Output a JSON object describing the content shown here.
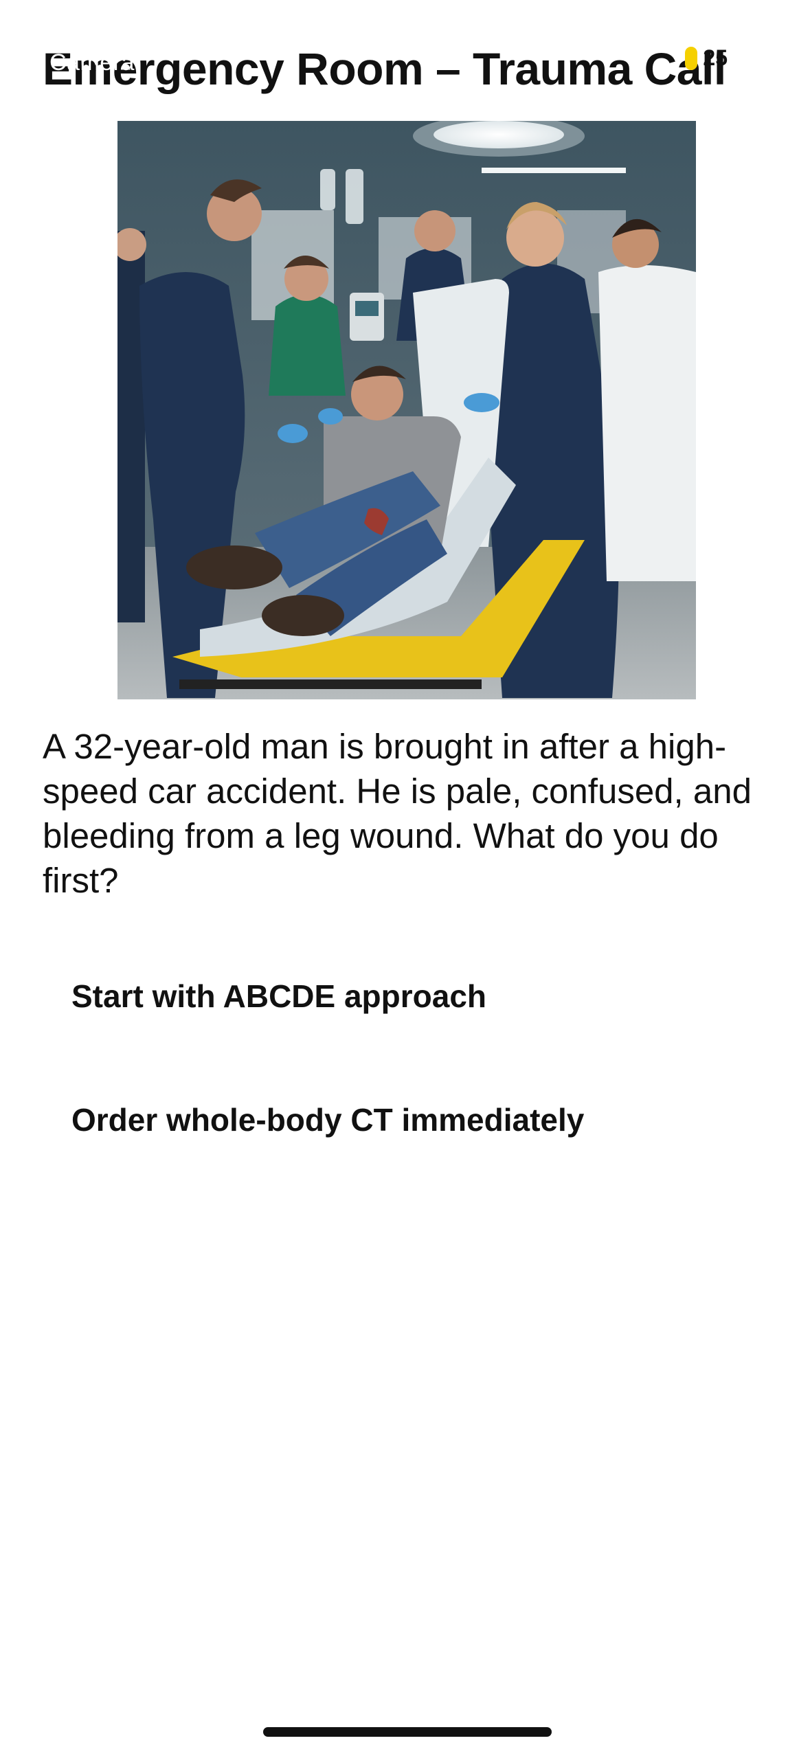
{
  "status_bar": {
    "carrier": "Camera",
    "badge": "25"
  },
  "header": {
    "title": "Emergency Room – Trauma Call"
  },
  "scene": {
    "icon": "trauma-room-illustration"
  },
  "question": {
    "text": "A 32-year-old man is brought in after a high-speed car accident. He is pale, confused, and bleeding from a leg wound. What do you do first?"
  },
  "choices": [
    {
      "label": "Start with ABCDE approach"
    },
    {
      "label": "Order whole-body CT immediately"
    }
  ],
  "colors": {
    "badge_dot": "#f5d000",
    "scrubs_navy": "#1f3352",
    "scrubs_green": "#1f7a5a",
    "stretcher_yellow": "#e8c21a"
  }
}
